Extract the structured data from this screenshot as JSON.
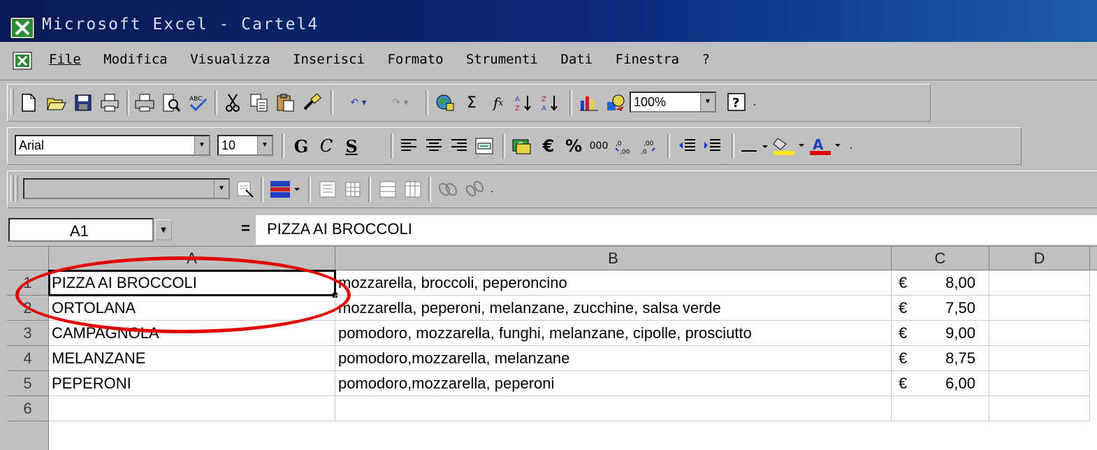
{
  "window": {
    "title": "Microsoft Excel - Cartel4"
  },
  "menu": {
    "items": [
      "File",
      "Modifica",
      "Visualizza",
      "Inserisci",
      "Formato",
      "Strumenti",
      "Dati",
      "Finestra",
      "?"
    ]
  },
  "toolbar_standard": {
    "icons": [
      "new-icon",
      "open-icon",
      "save-icon",
      "print-preview-printer-icon",
      "print-icon",
      "print-preview-icon",
      "spelling-icon",
      "cut-icon",
      "copy-icon",
      "paste-icon",
      "format-painter-icon",
      "undo-icon",
      "redo-icon",
      "web-toolbar-icon",
      "autosum-icon",
      "function-icon",
      "sort-ascending-icon",
      "sort-descending-icon",
      "chart-wizard-icon",
      "drawing-icon",
      "help-icon"
    ],
    "zoom": "100%"
  },
  "toolbar_formatting": {
    "font": "Arial",
    "size": "10",
    "bold": "G",
    "italic": "C",
    "underline": "S",
    "currency": "€",
    "percent": "%",
    "thousands": "000"
  },
  "formula_bar": {
    "name_box": "A1",
    "equals": "=",
    "value": "PIZZA AI BROCCOLI"
  },
  "columns": [
    "A",
    "B",
    "C",
    "D"
  ],
  "rows": [
    {
      "num": "1",
      "a": "PIZZA AI BROCCOLI",
      "b": "mozzarella, broccoli, peperoncino",
      "cur": "€",
      "price": "8,00"
    },
    {
      "num": "2",
      "a": "ORTOLANA",
      "b": "mozzarella, peperoni, melanzane, zucchine, salsa verde",
      "cur": "€",
      "price": "7,50"
    },
    {
      "num": "3",
      "a": "CAMPAGNOLA",
      "b": "pomodoro, mozzarella, funghi, melanzane, cipolle, prosciutto",
      "cur": "€",
      "price": "9,00"
    },
    {
      "num": "4",
      "a": "MELANZANE",
      "b": "pomodoro,mozzarella, melanzane",
      "cur": "€",
      "price": "8,75"
    },
    {
      "num": "5",
      "a": "PEPERONI",
      "b": "pomodoro,mozzarella, peperoni",
      "cur": "€",
      "price": "6,00"
    },
    {
      "num": "6",
      "a": "",
      "b": "",
      "cur": "",
      "price": ""
    }
  ],
  "colors": {
    "annotation": "#e00000",
    "title_bar": "#0a2a7a"
  }
}
